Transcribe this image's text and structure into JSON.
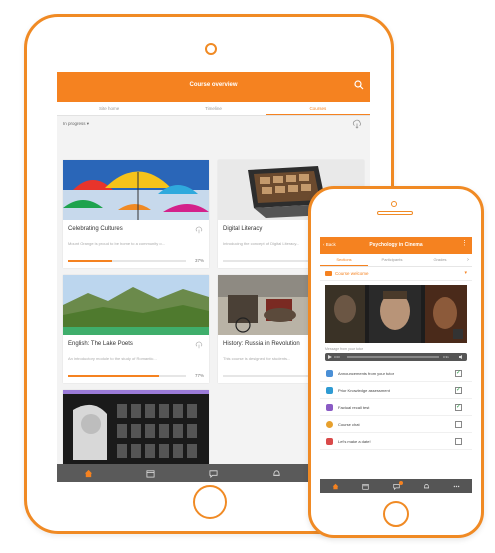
{
  "tablet": {
    "header_title": "Course overview",
    "tabs": [
      {
        "label": "Site home",
        "active": false
      },
      {
        "label": "Timeline",
        "active": false
      },
      {
        "label": "Courses",
        "active": true
      }
    ],
    "filter_label": "In progress ▾",
    "courses": [
      {
        "title": "Celebrating Cultures",
        "description": "Mount Orange is proud to be home to a community o...",
        "progress_percent": 37,
        "progress_label": "37%"
      },
      {
        "title": "Digital Literacy",
        "description": "Introducing the concept of Digital Literacy...",
        "progress_percent": 0,
        "progress_label": ""
      },
      {
        "title": "English: The Lake Poets",
        "description": "An introductory module to the study of Romantic...",
        "progress_percent": 77,
        "progress_label": "77%"
      },
      {
        "title": "History: Russia in Revolution",
        "description": "This course is designed for students...",
        "progress_percent": 0,
        "progress_label": ""
      }
    ],
    "nav_icons": [
      "home-icon",
      "calendar-icon",
      "chat-icon",
      "bell-icon",
      "more-icon"
    ]
  },
  "phone": {
    "back_label": "Back",
    "header_title": "Psychology in Cinema",
    "more_glyph": "⋮",
    "tabs": [
      {
        "label": "Sections",
        "active": true
      },
      {
        "label": "Participants",
        "active": false
      },
      {
        "label": "Grades",
        "active": false
      }
    ],
    "chevron": "›",
    "section_label": "Course welcome",
    "section_caret": "▾",
    "message_label": "Message from your tutor",
    "audio_time_left": "0:00",
    "audio_time_right": "0:31",
    "activities": [
      {
        "label": "Announcements from your tutor",
        "icon": "forum-icon",
        "icon_color": "#4a8fd6",
        "checked": true
      },
      {
        "label": "Prior Knowledge assessment",
        "icon": "feedback-icon",
        "icon_color": "#2f9bd3",
        "checked": true
      },
      {
        "label": "Factual recall test",
        "icon": "quiz-icon",
        "icon_color": "#8a5bc4",
        "checked": true
      },
      {
        "label": "Course chat",
        "icon": "chat-icon",
        "icon_color": "#e7a02d",
        "checked": false
      },
      {
        "label": "Let's make a date!",
        "icon": "choice-icon",
        "icon_color": "#d94a4a",
        "checked": false
      }
    ],
    "nav_icons": [
      "home-icon",
      "calendar-icon",
      "chat-icon",
      "bell-icon",
      "more-icon"
    ]
  },
  "colors": {
    "accent": "#f58220",
    "frame": "#f08a24",
    "nav_bg": "#5a5a5a"
  }
}
